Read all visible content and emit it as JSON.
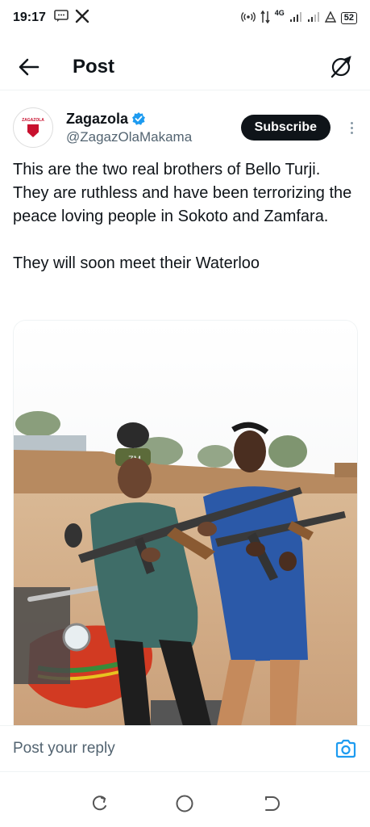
{
  "status_bar": {
    "time": "19:17",
    "battery": "52",
    "network": "4G",
    "icons": [
      "message-icon",
      "x-logo-icon",
      "hotspot-icon",
      "data-arrows-icon",
      "signal-icon",
      "signal-icon",
      "alarm-icon",
      "battery-icon"
    ]
  },
  "header": {
    "title": "Post",
    "back_icon": "arrow-left-icon",
    "grok_icon": "grok-icon"
  },
  "author": {
    "name": "Zagazola",
    "handle": "@ZagazOlaMakama",
    "verified": true,
    "avatar_text": "ZAGAZOLA",
    "subscribe_label": "Subscribe"
  },
  "tweet": {
    "paragraphs": [
      "This are the two real brothers of Bello Turji. They are ruthless and have been terrorizing the peace loving people in Sokoto and Zamfara.",
      "They will soon meet their Waterloo"
    ]
  },
  "media": {
    "cap_text": "ZM"
  },
  "reply": {
    "placeholder": "Post your reply",
    "camera_icon": "camera-icon"
  },
  "colors": {
    "accent": "#1d9bf0",
    "text": "#0f1419",
    "muted": "#536471",
    "border": "#eff3f4"
  }
}
